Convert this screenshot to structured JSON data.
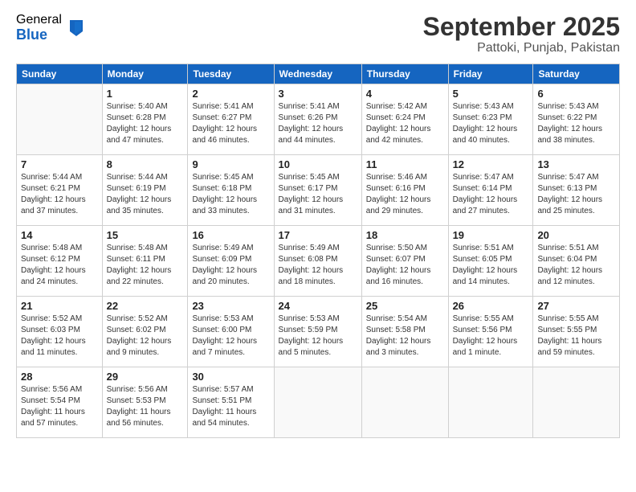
{
  "logo": {
    "general": "General",
    "blue": "Blue"
  },
  "title": "September 2025",
  "subtitle": "Pattoki, Punjab, Pakistan",
  "days_of_week": [
    "Sunday",
    "Monday",
    "Tuesday",
    "Wednesday",
    "Thursday",
    "Friday",
    "Saturday"
  ],
  "weeks": [
    [
      {
        "day": "",
        "info": ""
      },
      {
        "day": "1",
        "info": "Sunrise: 5:40 AM\nSunset: 6:28 PM\nDaylight: 12 hours\nand 47 minutes."
      },
      {
        "day": "2",
        "info": "Sunrise: 5:41 AM\nSunset: 6:27 PM\nDaylight: 12 hours\nand 46 minutes."
      },
      {
        "day": "3",
        "info": "Sunrise: 5:41 AM\nSunset: 6:26 PM\nDaylight: 12 hours\nand 44 minutes."
      },
      {
        "day": "4",
        "info": "Sunrise: 5:42 AM\nSunset: 6:24 PM\nDaylight: 12 hours\nand 42 minutes."
      },
      {
        "day": "5",
        "info": "Sunrise: 5:43 AM\nSunset: 6:23 PM\nDaylight: 12 hours\nand 40 minutes."
      },
      {
        "day": "6",
        "info": "Sunrise: 5:43 AM\nSunset: 6:22 PM\nDaylight: 12 hours\nand 38 minutes."
      }
    ],
    [
      {
        "day": "7",
        "info": "Sunrise: 5:44 AM\nSunset: 6:21 PM\nDaylight: 12 hours\nand 37 minutes."
      },
      {
        "day": "8",
        "info": "Sunrise: 5:44 AM\nSunset: 6:19 PM\nDaylight: 12 hours\nand 35 minutes."
      },
      {
        "day": "9",
        "info": "Sunrise: 5:45 AM\nSunset: 6:18 PM\nDaylight: 12 hours\nand 33 minutes."
      },
      {
        "day": "10",
        "info": "Sunrise: 5:45 AM\nSunset: 6:17 PM\nDaylight: 12 hours\nand 31 minutes."
      },
      {
        "day": "11",
        "info": "Sunrise: 5:46 AM\nSunset: 6:16 PM\nDaylight: 12 hours\nand 29 minutes."
      },
      {
        "day": "12",
        "info": "Sunrise: 5:47 AM\nSunset: 6:14 PM\nDaylight: 12 hours\nand 27 minutes."
      },
      {
        "day": "13",
        "info": "Sunrise: 5:47 AM\nSunset: 6:13 PM\nDaylight: 12 hours\nand 25 minutes."
      }
    ],
    [
      {
        "day": "14",
        "info": "Sunrise: 5:48 AM\nSunset: 6:12 PM\nDaylight: 12 hours\nand 24 minutes."
      },
      {
        "day": "15",
        "info": "Sunrise: 5:48 AM\nSunset: 6:11 PM\nDaylight: 12 hours\nand 22 minutes."
      },
      {
        "day": "16",
        "info": "Sunrise: 5:49 AM\nSunset: 6:09 PM\nDaylight: 12 hours\nand 20 minutes."
      },
      {
        "day": "17",
        "info": "Sunrise: 5:49 AM\nSunset: 6:08 PM\nDaylight: 12 hours\nand 18 minutes."
      },
      {
        "day": "18",
        "info": "Sunrise: 5:50 AM\nSunset: 6:07 PM\nDaylight: 12 hours\nand 16 minutes."
      },
      {
        "day": "19",
        "info": "Sunrise: 5:51 AM\nSunset: 6:05 PM\nDaylight: 12 hours\nand 14 minutes."
      },
      {
        "day": "20",
        "info": "Sunrise: 5:51 AM\nSunset: 6:04 PM\nDaylight: 12 hours\nand 12 minutes."
      }
    ],
    [
      {
        "day": "21",
        "info": "Sunrise: 5:52 AM\nSunset: 6:03 PM\nDaylight: 12 hours\nand 11 minutes."
      },
      {
        "day": "22",
        "info": "Sunrise: 5:52 AM\nSunset: 6:02 PM\nDaylight: 12 hours\nand 9 minutes."
      },
      {
        "day": "23",
        "info": "Sunrise: 5:53 AM\nSunset: 6:00 PM\nDaylight: 12 hours\nand 7 minutes."
      },
      {
        "day": "24",
        "info": "Sunrise: 5:53 AM\nSunset: 5:59 PM\nDaylight: 12 hours\nand 5 minutes."
      },
      {
        "day": "25",
        "info": "Sunrise: 5:54 AM\nSunset: 5:58 PM\nDaylight: 12 hours\nand 3 minutes."
      },
      {
        "day": "26",
        "info": "Sunrise: 5:55 AM\nSunset: 5:56 PM\nDaylight: 12 hours\nand 1 minute."
      },
      {
        "day": "27",
        "info": "Sunrise: 5:55 AM\nSunset: 5:55 PM\nDaylight: 11 hours\nand 59 minutes."
      }
    ],
    [
      {
        "day": "28",
        "info": "Sunrise: 5:56 AM\nSunset: 5:54 PM\nDaylight: 11 hours\nand 57 minutes."
      },
      {
        "day": "29",
        "info": "Sunrise: 5:56 AM\nSunset: 5:53 PM\nDaylight: 11 hours\nand 56 minutes."
      },
      {
        "day": "30",
        "info": "Sunrise: 5:57 AM\nSunset: 5:51 PM\nDaylight: 11 hours\nand 54 minutes."
      },
      {
        "day": "",
        "info": ""
      },
      {
        "day": "",
        "info": ""
      },
      {
        "day": "",
        "info": ""
      },
      {
        "day": "",
        "info": ""
      }
    ]
  ]
}
